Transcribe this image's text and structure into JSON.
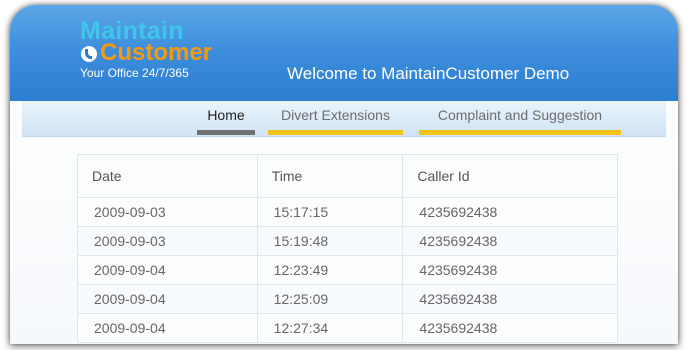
{
  "header": {
    "logo": {
      "line1": "Maintain",
      "line2": "Customer",
      "tagline": "Your Office 24/7/365",
      "icon": "phone-icon"
    },
    "welcome": "Welcome to MaintainCustomer Demo"
  },
  "nav": {
    "tabs": [
      {
        "label": "Home",
        "active": true
      },
      {
        "label": "Divert Extensions",
        "active": false
      },
      {
        "label": "Complaint and Suggestion",
        "active": false
      }
    ]
  },
  "table": {
    "columns": [
      "Date",
      "Time",
      "Caller Id"
    ],
    "rows": [
      [
        "2009-09-03",
        "15:17:15",
        "4235692438"
      ],
      [
        "2009-09-03",
        "15:19:48",
        "4235692438"
      ],
      [
        "2009-09-04",
        "12:23:49",
        "4235692438"
      ],
      [
        "2009-09-04",
        "12:25:09",
        "4235692438"
      ],
      [
        "2009-09-04",
        "12:27:34",
        "4235692438"
      ]
    ]
  },
  "colors": {
    "header": "#2d7dd2",
    "logo_cyan": "#3fc6ea",
    "logo_orange": "#f59a0f",
    "tab_underline": "#f2c41a",
    "active_tab_underline": "#707070"
  }
}
